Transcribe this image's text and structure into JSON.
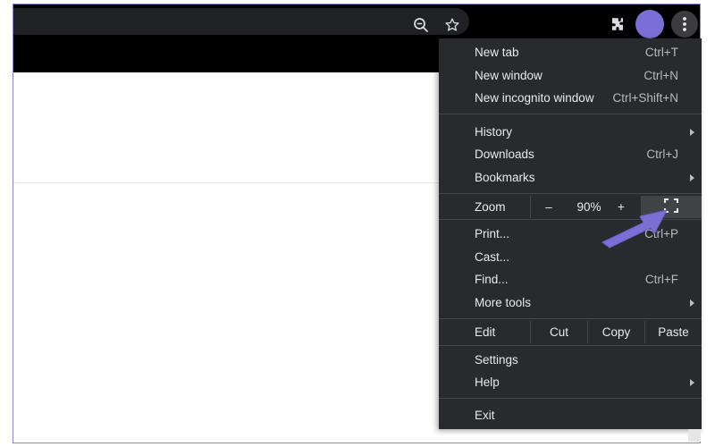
{
  "icons": {
    "zoom": "zoom-out-magnifier-icon",
    "bookmark": "star-icon",
    "extensions": "puzzle-icon",
    "menu": "three-dot-menu-icon",
    "fullscreen": "fullscreen-icon",
    "pointer": "arrow-pointer"
  },
  "colors": {
    "accent": "#7b6fd6",
    "menu_bg": "#292a2d",
    "menu_text": "#e8eaed"
  },
  "menu": {
    "group1": [
      {
        "label": "New tab",
        "shortcut": "Ctrl+T"
      },
      {
        "label": "New window",
        "shortcut": "Ctrl+N"
      },
      {
        "label": "New incognito window",
        "shortcut": "Ctrl+Shift+N"
      }
    ],
    "group2": [
      {
        "label": "History",
        "shortcut": ""
      },
      {
        "label": "Downloads",
        "shortcut": "Ctrl+J"
      },
      {
        "label": "Bookmarks",
        "shortcut": ""
      }
    ],
    "zoom": {
      "label": "Zoom",
      "minus": "–",
      "value": "90%",
      "plus": "+"
    },
    "group3": [
      {
        "label": "Print...",
        "shortcut": "Ctrl+P"
      },
      {
        "label": "Cast...",
        "shortcut": ""
      },
      {
        "label": "Find...",
        "shortcut": "Ctrl+F"
      },
      {
        "label": "More tools",
        "shortcut": ""
      }
    ],
    "edit": {
      "label": "Edit",
      "cut": "Cut",
      "copy": "Copy",
      "paste": "Paste"
    },
    "group4": [
      {
        "label": "Settings"
      },
      {
        "label": "Help"
      }
    ],
    "exit": "Exit"
  }
}
